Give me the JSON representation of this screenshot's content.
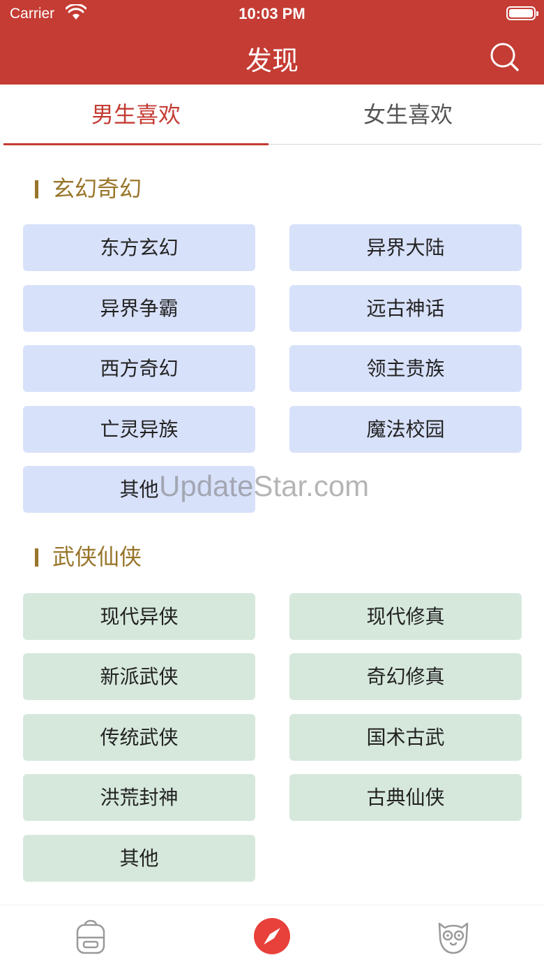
{
  "status_bar": {
    "carrier": "Carrier",
    "time": "10:03 PM"
  },
  "header": {
    "title": "发现"
  },
  "tabs": [
    {
      "label": "男生喜欢",
      "active": true
    },
    {
      "label": "女生喜欢",
      "active": false
    }
  ],
  "sections": [
    {
      "title": "玄幻奇幻",
      "items": [
        "东方玄幻",
        "异界大陆",
        "异界争霸",
        "远古神话",
        "西方奇幻",
        "领主贵族",
        "亡灵异族",
        "魔法校园",
        "其他"
      ]
    },
    {
      "title": "武侠仙侠",
      "items": [
        "现代异侠",
        "现代修真",
        "新派武侠",
        "奇幻修真",
        "传统武侠",
        "国术古武",
        "洪荒封神",
        "古典仙侠",
        "其他"
      ]
    }
  ],
  "watermark": "UpdateStar.com",
  "colors": {
    "primary": "#c43c34",
    "section": "#98752a",
    "chip_blue": "#d8e1fa",
    "chip_green": "#d6e8dc"
  },
  "tab_bar_icons": [
    "backpack-icon",
    "compass-icon",
    "owl-icon"
  ]
}
